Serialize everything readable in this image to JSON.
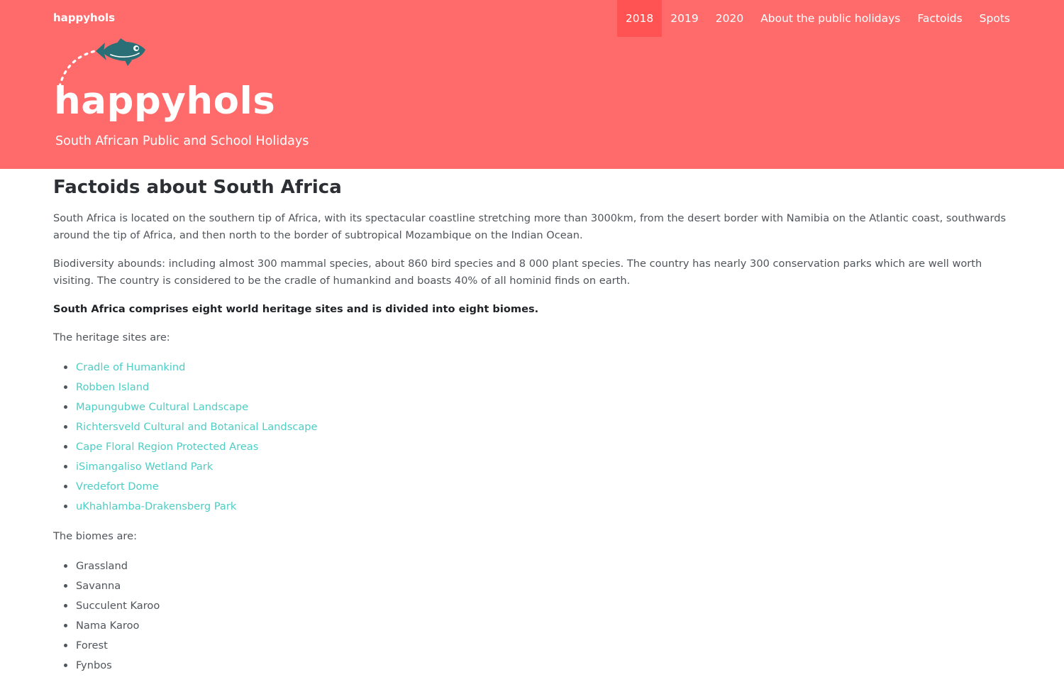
{
  "nav": {
    "brand": "happyhols",
    "items": [
      {
        "label": "2018",
        "active": true
      },
      {
        "label": "2019",
        "active": false
      },
      {
        "label": "2020",
        "active": false
      },
      {
        "label": "About the public holidays",
        "active": false
      },
      {
        "label": "Factoids",
        "active": false
      },
      {
        "label": "Spots",
        "active": false
      }
    ]
  },
  "hero": {
    "logo_text": "happyhols",
    "tagline": "South African Public and School Holidays",
    "logo_icon": "fish-icon"
  },
  "colors": {
    "header_bg": "#ff6b6b",
    "nav_active_bg": "#ff5252",
    "link": "#4ecdc4",
    "fish": "#2a6f75"
  },
  "main": {
    "title": "Factoids about South Africa",
    "intro_1": "South Africa is located on the southern tip of Africa, with its spectacular coastline stretching more than 3000km, from the desert border with Namibia on the Atlantic coast, southwards around the tip of Africa, and then north to the border of subtropical Mozambique on the Indian Ocean.",
    "intro_2": "Biodiversity abounds: including almost 300 mammal species, about 860 bird species and 8 000 plant species. The country has nearly 300 conservation parks which are well worth visiting. The country is considered to be the cradle of humankind and boasts 40% of all hominid finds on earth.",
    "summary": "South Africa comprises eight world heritage sites and is divided into eight biomes.",
    "heritage_heading": "The heritage sites are:",
    "heritage_sites": [
      "Cradle of Humankind",
      "Robben Island",
      "Mapungubwe Cultural Landscape",
      "Richtersveld Cultural and Botanical Landscape",
      "Cape Floral Region Protected Areas",
      "iSimangaliso Wetland Park",
      "Vredefort Dome",
      "uKhahlamba-Drakensberg Park"
    ],
    "biomes_heading": "The biomes are:",
    "biomes": [
      "Grassland",
      "Savanna",
      "Succulent Karoo",
      "Nama Karoo",
      "Forest",
      "Fynbos"
    ]
  }
}
